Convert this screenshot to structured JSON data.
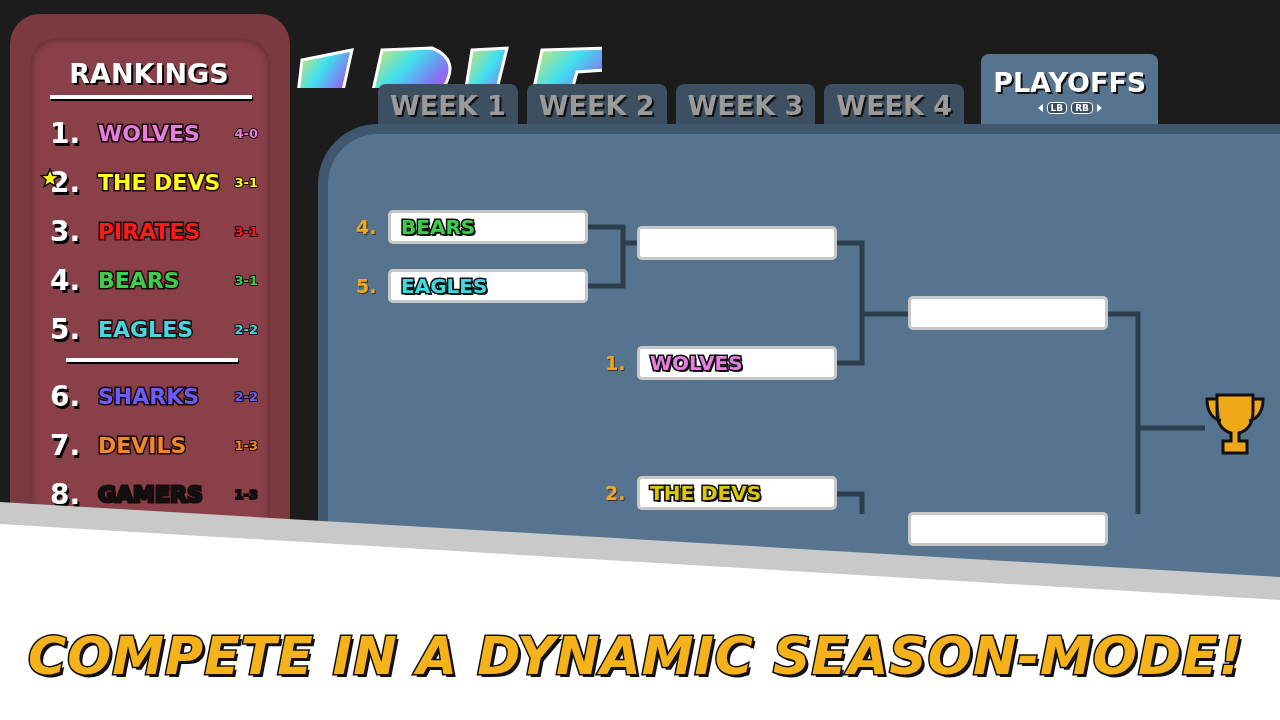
{
  "rankings": {
    "title": "RANKINGS",
    "teams": [
      {
        "rank": "1.",
        "name": "WOLVES",
        "record": "4-0",
        "color": "#e67ee0",
        "starred": false
      },
      {
        "rank": "2.",
        "name": "THE DEVS",
        "record": "3-1",
        "color": "#ffff1a",
        "starred": true
      },
      {
        "rank": "3.",
        "name": "PIRATES",
        "record": "3-1",
        "color": "#ff1a1a",
        "starred": false
      },
      {
        "rank": "4.",
        "name": "BEARS",
        "record": "3-1",
        "color": "#3ccf4f",
        "starred": false
      },
      {
        "rank": "5.",
        "name": "EAGLES",
        "record": "2-2",
        "color": "#3fd9e0",
        "starred": false
      },
      {
        "rank": "6.",
        "name": "SHARKS",
        "record": "2-2",
        "color": "#6a5cff",
        "starred": false
      },
      {
        "rank": "7.",
        "name": "DEVILS",
        "record": "1-3",
        "color": "#f0892a",
        "starred": false
      },
      {
        "rank": "8.",
        "name": "GAMERS",
        "record": "1-3",
        "color": "#111111",
        "starred": false
      }
    ]
  },
  "tabs": [
    {
      "label": "WEEK 1",
      "selected": false
    },
    {
      "label": "WEEK 2",
      "selected": false
    },
    {
      "label": "WEEK 3",
      "selected": false
    },
    {
      "label": "WEEK 4",
      "selected": false
    },
    {
      "label": "PLAYOFFS",
      "selected": true
    }
  ],
  "tab_hints": [
    "LB",
    "RB"
  ],
  "bracket": {
    "slots": [
      {
        "kind": "team",
        "seed": "4.",
        "team": "BEARS",
        "color": "#3ccf4f"
      },
      {
        "kind": "team",
        "seed": "5.",
        "team": "EAGLES",
        "color": "#3fd9e0"
      },
      {
        "kind": "empty"
      },
      {
        "kind": "team",
        "seed": "1.",
        "team": "WOLVES",
        "color": "#e67ee0"
      },
      {
        "kind": "empty"
      },
      {
        "kind": "team",
        "seed": "2.",
        "team": "THE DEVS",
        "color": "#dcc800"
      },
      {
        "kind": "empty"
      }
    ]
  },
  "banner": {
    "text": "COMPETE IN A DYNAMIC SEASON-MODE!"
  }
}
